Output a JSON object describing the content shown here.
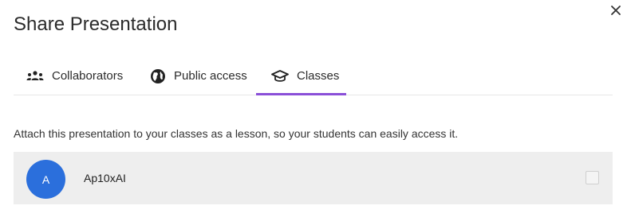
{
  "dialog": {
    "title": "Share Presentation",
    "close_icon": "close-icon"
  },
  "tabs": [
    {
      "label": "Collaborators",
      "icon": "people-group-icon",
      "active": false
    },
    {
      "label": "Public access",
      "icon": "globe-icon",
      "active": false
    },
    {
      "label": "Classes",
      "icon": "graduation-cap-icon",
      "active": true
    }
  ],
  "classes_panel": {
    "description": "Attach this presentation to your classes as a lesson, so your students can easily access it.",
    "items": [
      {
        "avatar_letter": "A",
        "name": "Ap10xAI",
        "checked": false
      }
    ]
  },
  "colors": {
    "active_tab_underline": "#8a4fd8",
    "avatar_bg": "#2b6fdc",
    "row_bg": "#eeeeee"
  }
}
